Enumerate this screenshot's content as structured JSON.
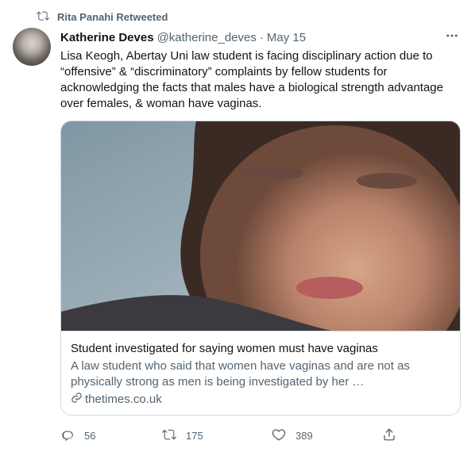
{
  "retweeted_by": "Rita Panahi Retweeted",
  "author": {
    "name": "Katherine Deves",
    "handle": "@katherine_deves",
    "separator": "·",
    "date": "May 15"
  },
  "tweet_text": "Lisa Keogh, Abertay Uni law student is facing disciplinary action due to “offensive” & “discriminatory” complaints by fellow students for acknowledging the facts that males have a biological strength advantage over females, & woman have vaginas.",
  "card": {
    "title": "Student investigated for saying women must have vaginas",
    "description": "A law student who said that women have vaginas and are not as physically strong as men is being investigated by her …",
    "domain": "thetimes.co.uk"
  },
  "actions": {
    "reply_count": "56",
    "retweet_count": "175",
    "like_count": "389"
  },
  "icons": {
    "retweet": "retweet-icon",
    "more": "more-icon",
    "link": "link-icon",
    "reply": "reply-icon",
    "like": "heart-icon",
    "share": "share-icon"
  },
  "colors": {
    "text": "#0f1419",
    "secondary": "#536471",
    "border": "#cfd9de"
  }
}
